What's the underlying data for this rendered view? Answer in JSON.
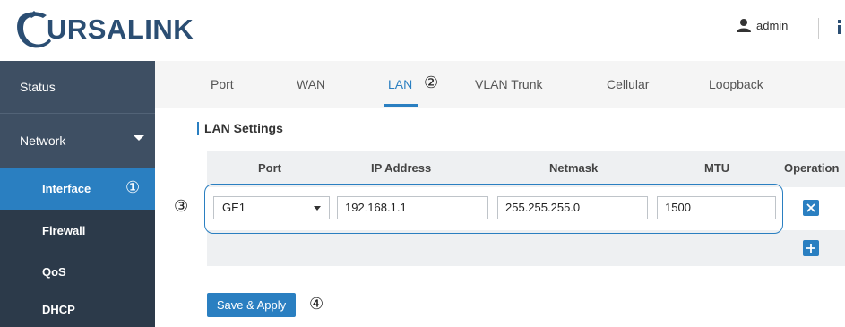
{
  "header": {
    "brand": "URSALINK",
    "user": "admin"
  },
  "sidebar": {
    "items": [
      {
        "label": "Status"
      },
      {
        "label": "Network"
      },
      {
        "label": "Interface"
      },
      {
        "label": "Firewall"
      },
      {
        "label": "QoS"
      },
      {
        "label": "DHCP"
      }
    ]
  },
  "tabs": [
    {
      "label": "Port"
    },
    {
      "label": "WAN"
    },
    {
      "label": "LAN"
    },
    {
      "label": "VLAN Trunk"
    },
    {
      "label": "Cellular"
    },
    {
      "label": "Loopback"
    }
  ],
  "annotations": [
    "①",
    "②",
    "③",
    "④"
  ],
  "section_title": "LAN Settings",
  "table": {
    "headers": [
      "Port",
      "IP Address",
      "Netmask",
      "MTU",
      "Operation"
    ],
    "row": {
      "port": "GE1",
      "ip": "192.168.1.1",
      "netmask": "255.255.255.0",
      "mtu": "1500"
    }
  },
  "save_label": "Save & Apply",
  "icons": [
    "logo-icon",
    "user-icon",
    "chevron-down-icon",
    "dropdown-arrow-icon",
    "delete-icon",
    "add-icon"
  ],
  "colors": {
    "accent": "#2a7fc1",
    "sidebar_bg": "#3e4f63",
    "brand": "#2b4e73"
  }
}
